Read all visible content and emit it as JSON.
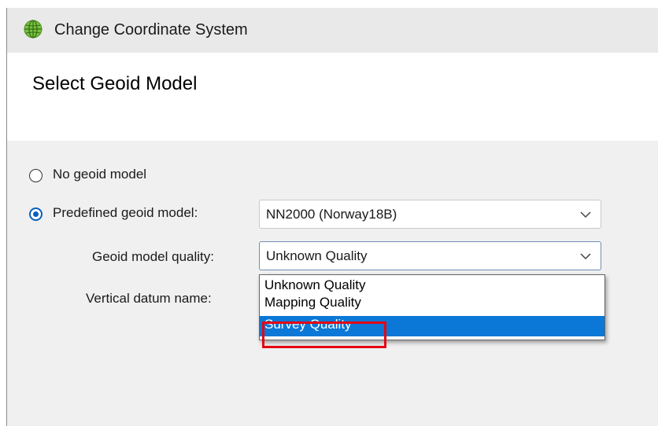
{
  "window": {
    "title": "Change Coordinate System",
    "icon": "globe-icon"
  },
  "header": {
    "title": "Select Geoid Model"
  },
  "options": {
    "no_geoid_label": "No geoid model",
    "no_geoid_selected": false,
    "predefined_label": "Predefined geoid model:",
    "predefined_selected": true
  },
  "geoid_model": {
    "value": "NN2000 (Norway18B)"
  },
  "geoid_quality": {
    "label": "Geoid model quality:",
    "value": "Unknown Quality",
    "options": [
      "Unknown Quality",
      "Mapping Quality",
      "Survey Quality"
    ],
    "highlighted_index": 2
  },
  "vertical_datum": {
    "label": "Vertical datum name:"
  },
  "colors": {
    "accent": "#0a5fbd",
    "selection": "#0b78d7",
    "annotation": "#e30613"
  }
}
